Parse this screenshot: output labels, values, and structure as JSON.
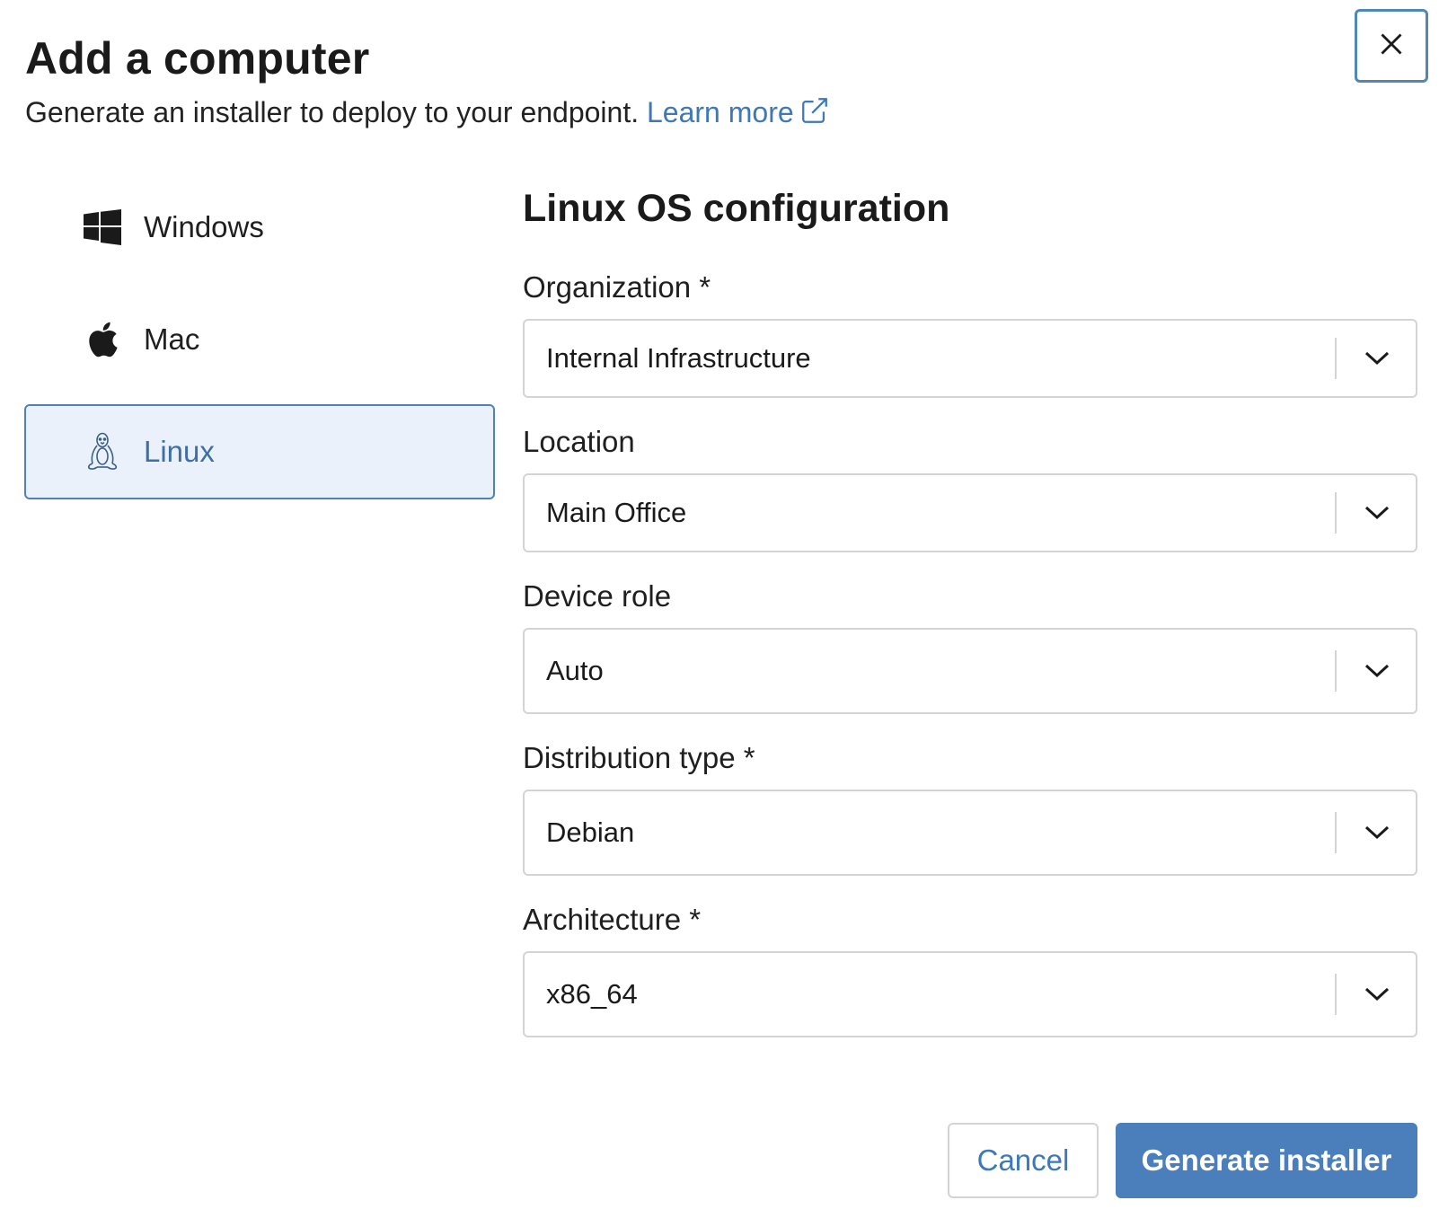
{
  "dialog": {
    "title": "Add a computer",
    "subtitle": "Generate an installer to deploy to your endpoint.",
    "learn_more": "Learn more",
    "close_icon": "close-icon"
  },
  "os_options": [
    {
      "label": "Windows",
      "icon": "windows-icon",
      "active": false
    },
    {
      "label": "Mac",
      "icon": "apple-icon",
      "active": false
    },
    {
      "label": "Linux",
      "icon": "linux-penguin-icon",
      "active": true
    }
  ],
  "config": {
    "title": "Linux OS configuration",
    "fields": [
      {
        "label": "Organization *",
        "value": "Internal Infrastructure"
      },
      {
        "label": "Location",
        "value": "Main Office"
      },
      {
        "label": "Device role",
        "value": "Auto"
      },
      {
        "label": "Distribution type *",
        "value": "Debian"
      },
      {
        "label": "Architecture *",
        "value": "x86_64"
      }
    ]
  },
  "actions": {
    "cancel": "Cancel",
    "generate": "Generate installer"
  },
  "colors": {
    "accent": "#4a7fbb",
    "link": "#3d78b8",
    "active_bg": "#eaf1fa"
  }
}
